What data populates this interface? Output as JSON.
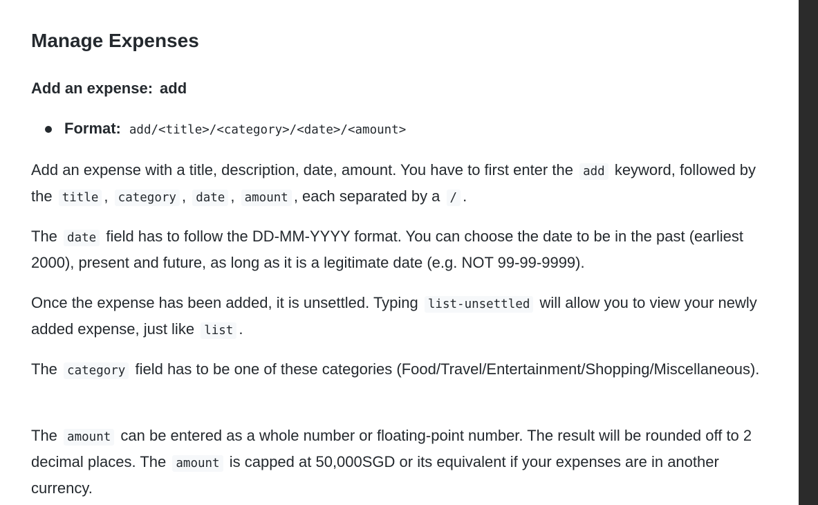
{
  "section": {
    "title": "Manage Expenses",
    "subtitle": "Add an expense:",
    "command": "add"
  },
  "format": {
    "label": "Format:",
    "code": "add/<title>/<category>/<date>/<amount>"
  },
  "paragraphs": {
    "p1": {
      "t1": "Add an expense with a title, description, date, amount. You have to first enter the",
      "c1": "add",
      "t2": "keyword, followed by the",
      "c2": "title",
      "t3": ",",
      "c3": "category",
      "t4": ",",
      "c4": "date",
      "t5": ",",
      "c5": "amount",
      "t6": ", each separated by a",
      "c6": "/",
      "t7": "."
    },
    "p2": {
      "t1": "The",
      "c1": "date",
      "t2": "field has to follow the DD-MM-YYYY format. You can choose the date to be in the past (earliest 2000), present and future, as long as it is a legitimate date (e.g. NOT 99-99-9999)."
    },
    "p3": {
      "t1": "Once the expense has been added, it is unsettled. Typing",
      "c1": "list-unsettled",
      "t2": "will allow you to view your newly added expense, just like",
      "c2": "list",
      "t3": "."
    },
    "p4": {
      "t1": "The",
      "c1": "category",
      "t2": "field has to be one of these categories (Food/Travel/Entertainment/Shopping/Miscellaneous)."
    },
    "p5": {
      "t1": "The",
      "c1": "amount",
      "t2": "can be entered as a whole number or floating-point number. The result will be rounded off to 2 decimal places. The",
      "c2": "amount",
      "t3": "is capped at 50,000SGD or its equivalent if your expenses are in another currency."
    }
  }
}
